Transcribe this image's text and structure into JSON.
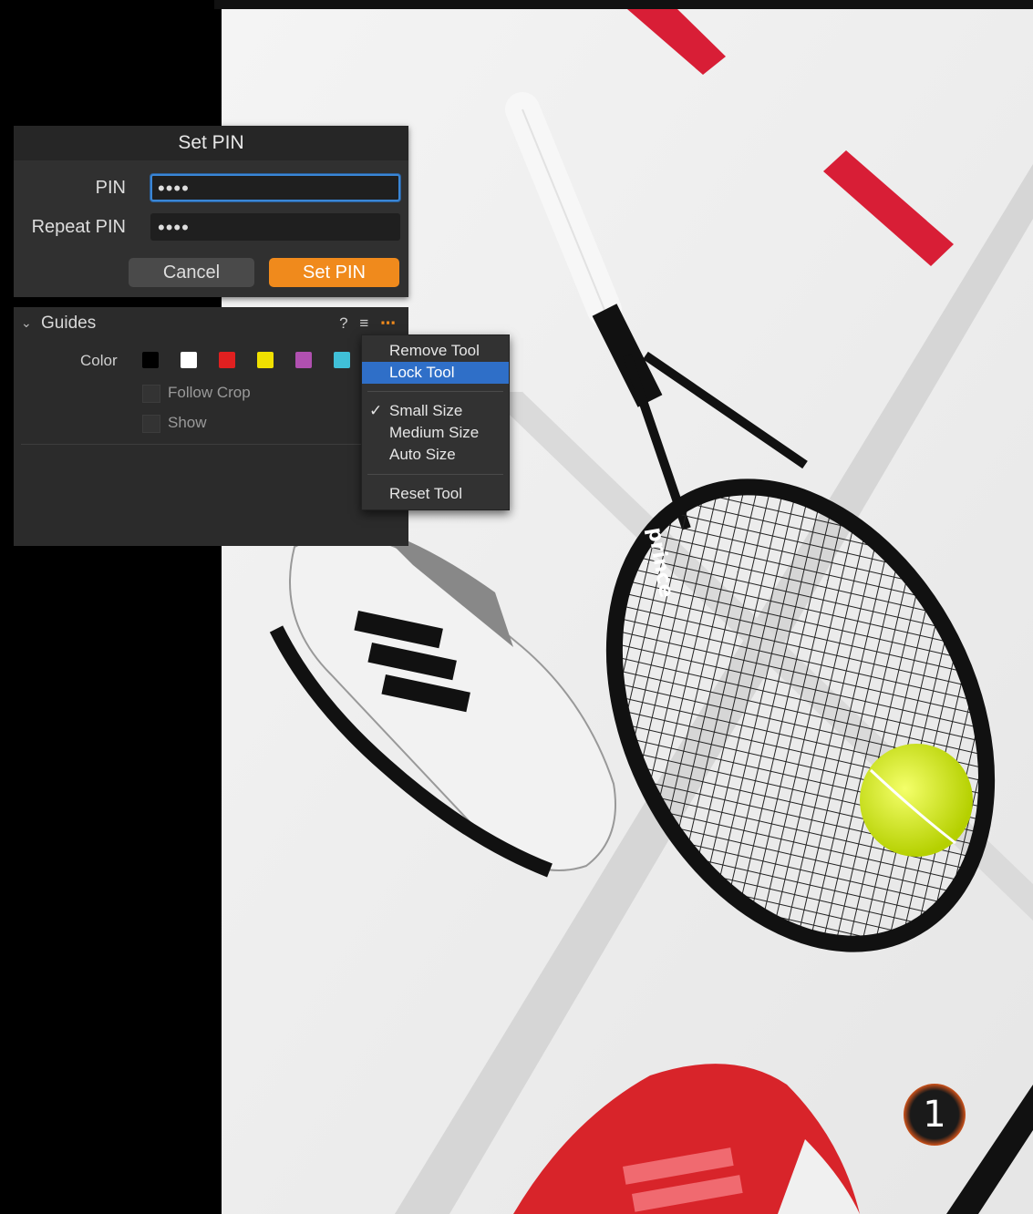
{
  "set_pin_dialog": {
    "title": "Set PIN",
    "pin_label": "PIN",
    "pin_value": "••••",
    "repeat_label": "Repeat PIN",
    "repeat_value": "••••",
    "cancel_label": "Cancel",
    "confirm_label": "Set PIN"
  },
  "guides_panel": {
    "title": "Guides",
    "help_icon": "?",
    "color_label": "Color",
    "swatches": [
      "#000000",
      "#ffffff",
      "#e02020",
      "#f0e000",
      "#b050b0",
      "#40c0d8"
    ],
    "follow_crop_label": "Follow Crop",
    "show_label": "Show"
  },
  "context_menu": {
    "items": [
      {
        "label": "Remove Tool"
      },
      {
        "label": "Lock Tool",
        "highlighted": true
      },
      {
        "label": "Small Size",
        "checked": true
      },
      {
        "label": "Medium Size"
      },
      {
        "label": "Auto Size"
      },
      {
        "label": "Reset Tool"
      }
    ]
  },
  "photo": {
    "racket_brand": "prince"
  },
  "step_badge": "1",
  "colors": {
    "accent_orange": "#f08a1c",
    "menu_highlight": "#2f6fc8",
    "focus_blue": "#3a86d6"
  }
}
